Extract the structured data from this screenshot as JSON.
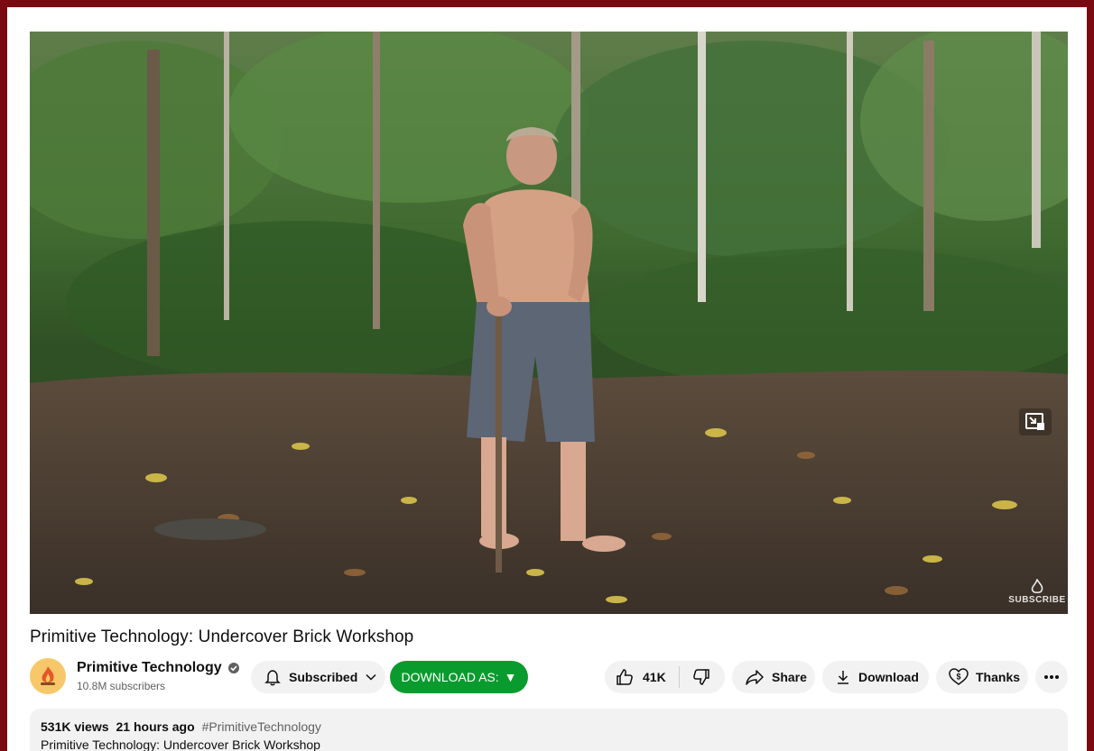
{
  "video": {
    "title": "Primitive Technology: Undercover Brick Workshop",
    "watermark": "SUBSCRIBE"
  },
  "channel": {
    "name": "Primitive Technology",
    "subscribers": "10.8M subscribers"
  },
  "actions": {
    "subscribed_label": "Subscribed",
    "download_as_label": "DOWNLOAD AS:",
    "download_as_arrow": "▼",
    "likes": "41K",
    "share_label": "Share",
    "download_label": "Download",
    "thanks_label": "Thanks"
  },
  "description": {
    "views": "531K views",
    "age": "21 hours ago",
    "hashtag": "#PrimitiveTechnology",
    "partial_line": "Primitive Technology: Undercover Brick Workshop"
  },
  "colors": {
    "outer_border": "#7a0a12",
    "download_as_bg": "#0a9b2e",
    "pill_bg": "#f2f2f2"
  },
  "icons": [
    "fullscreen-exit-icon",
    "verified-icon",
    "bell-icon",
    "chevron-down-icon",
    "thumbs-up-icon",
    "thumbs-down-icon",
    "share-arrow-icon",
    "download-icon",
    "thanks-icon",
    "more-icon"
  ]
}
